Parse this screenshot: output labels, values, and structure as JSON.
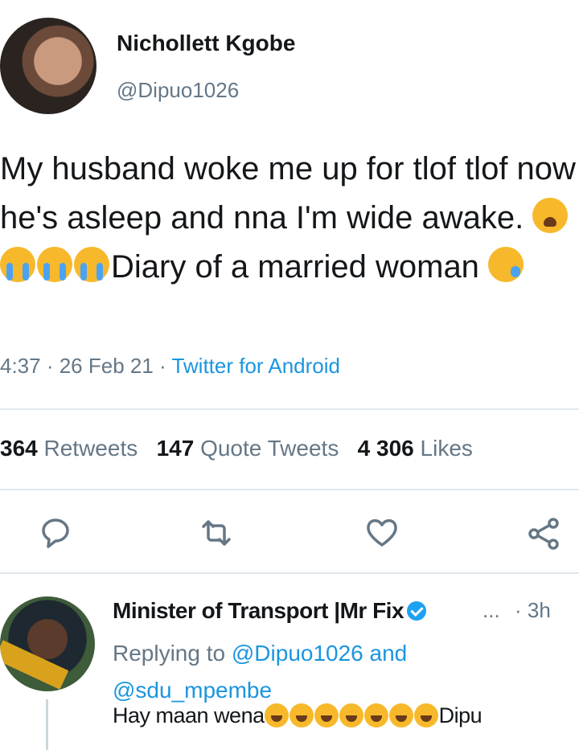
{
  "tweet": {
    "author_name": "Nichollett Kgobe",
    "author_handle": "@Dipuo1026",
    "text_part1": "My husband woke me up for tlof tlof now he's asleep and nna I'm wide awake. ",
    "text_part2": "Diary of a married woman ",
    "emojis_after_part1": [
      "weary-face",
      "loudly-crying-face",
      "loudly-crying-face",
      "loudly-crying-face"
    ],
    "emoji_after_part2": "sleepy-face",
    "time": "4:37",
    "date": "26 Feb 21",
    "source": "Twitter for Android",
    "retweets_count": "364",
    "retweets_label": "Retweets",
    "quote_count": "147",
    "quote_label": "Quote Tweets",
    "likes_count": "4 306",
    "likes_label": "Likes"
  },
  "actions": {
    "icons": [
      "reply-icon",
      "retweet-icon",
      "like-icon",
      "share-icon"
    ]
  },
  "reply": {
    "author_name": "Minister of Transport |Mr Fix",
    "more": "...",
    "time": "· 3h",
    "replying_prefix": "Replying to",
    "replying_to_1": "@Dipuo1026",
    "replying_and": "and",
    "replying_to_2": "@sdu_mpembe",
    "text": "Hay maan wena",
    "text_suffix": "Dipu",
    "emoji_count": 7,
    "emoji": "rolling-on-floor-laughing"
  },
  "colors": {
    "text": "#14171a",
    "muted": "#657786",
    "link": "#1b95e0",
    "divider": "#e1e8ed"
  }
}
